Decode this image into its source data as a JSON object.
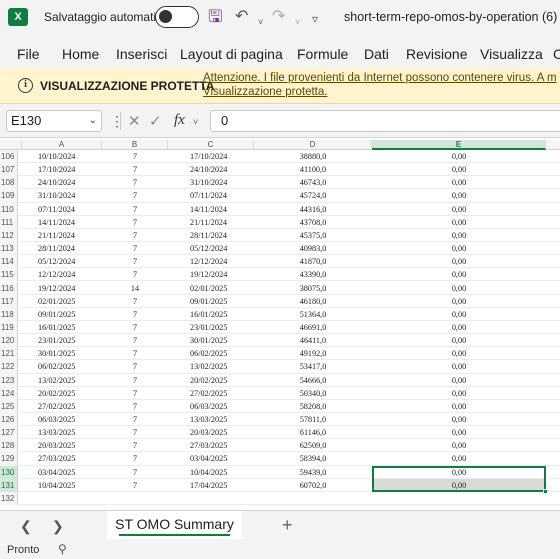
{
  "titlebar": {
    "app_logo": "X",
    "autosave_label": "Salvataggio automatico",
    "autosave_state": "off",
    "save_icon": "save-icon",
    "undo_icon": "undo-icon",
    "redo_icon": "redo-icon",
    "document_title": "short-term-repo-omos-by-operation (6) -"
  },
  "ribbon": {
    "tabs": [
      "File",
      "Home",
      "Inserisci",
      "Layout di pagina",
      "Formule",
      "Dati",
      "Revisione",
      "Visualizza",
      "C"
    ]
  },
  "protected_view": {
    "title": "VISUALIZZAZIONE PROTETTA",
    "message_line1": "Attenzione. I file provenienti da Internet possono contenere virus. A m",
    "message_line2": "Visualizzazione protetta."
  },
  "formula_bar": {
    "name_box": "E130",
    "cancel_icon": "close-icon",
    "confirm_icon": "check-icon",
    "fx_label": "fx",
    "value": "0"
  },
  "grid": {
    "columns": [
      "A",
      "B",
      "C",
      "D",
      "E"
    ],
    "selected_column": "E",
    "selected_cell": "E130",
    "rows": [
      {
        "n": "106",
        "a": "10/10/2024",
        "b": "7",
        "c": "17/10/2024",
        "d": "38880,0",
        "e": "0,00"
      },
      {
        "n": "107",
        "a": "17/10/2024",
        "b": "7",
        "c": "24/10/2024",
        "d": "41100,0",
        "e": "0,00"
      },
      {
        "n": "108",
        "a": "24/10/2024",
        "b": "7",
        "c": "31/10/2024",
        "d": "46743,0",
        "e": "0,00"
      },
      {
        "n": "109",
        "a": "31/10/2024",
        "b": "7",
        "c": "07/11/2024",
        "d": "45724,0",
        "e": "0,00"
      },
      {
        "n": "110",
        "a": "07/11/2024",
        "b": "7",
        "c": "14/11/2024",
        "d": "44316,0",
        "e": "0,00"
      },
      {
        "n": "111",
        "a": "14/11/2024",
        "b": "7",
        "c": "21/11/2024",
        "d": "43708,0",
        "e": "0,00"
      },
      {
        "n": "112",
        "a": "21/11/2024",
        "b": "7",
        "c": "28/11/2024",
        "d": "45375,0",
        "e": "0,00"
      },
      {
        "n": "113",
        "a": "28/11/2024",
        "b": "7",
        "c": "05/12/2024",
        "d": "40983,0",
        "e": "0,00"
      },
      {
        "n": "114",
        "a": "05/12/2024",
        "b": "7",
        "c": "12/12/2024",
        "d": "41870,0",
        "e": "0,00"
      },
      {
        "n": "115",
        "a": "12/12/2024",
        "b": "7",
        "c": "19/12/2024",
        "d": "43390,0",
        "e": "0,00"
      },
      {
        "n": "116",
        "a": "19/12/2024",
        "b": "14",
        "c": "02/01/2025",
        "d": "38075,0",
        "e": "0,00"
      },
      {
        "n": "117",
        "a": "02/01/2025",
        "b": "7",
        "c": "09/01/2025",
        "d": "46180,0",
        "e": "0,00"
      },
      {
        "n": "118",
        "a": "09/01/2025",
        "b": "7",
        "c": "16/01/2025",
        "d": "51364,0",
        "e": "0,00"
      },
      {
        "n": "119",
        "a": "16/01/2025",
        "b": "7",
        "c": "23/01/2025",
        "d": "46691,0",
        "e": "0,00"
      },
      {
        "n": "120",
        "a": "23/01/2025",
        "b": "7",
        "c": "30/01/2025",
        "d": "46411,0",
        "e": "0,00"
      },
      {
        "n": "121",
        "a": "30/01/2025",
        "b": "7",
        "c": "06/02/2025",
        "d": "49192,0",
        "e": "0,00"
      },
      {
        "n": "122",
        "a": "06/02/2025",
        "b": "7",
        "c": "13/02/2025",
        "d": "53417,0",
        "e": "0,00"
      },
      {
        "n": "123",
        "a": "13/02/2025",
        "b": "7",
        "c": "20/02/2025",
        "d": "54666,0",
        "e": "0,00"
      },
      {
        "n": "124",
        "a": "20/02/2025",
        "b": "7",
        "c": "27/02/2025",
        "d": "50340,0",
        "e": "0,00"
      },
      {
        "n": "125",
        "a": "27/02/2025",
        "b": "7",
        "c": "06/03/2025",
        "d": "58208,0",
        "e": "0,00"
      },
      {
        "n": "126",
        "a": "06/03/2025",
        "b": "7",
        "c": "13/03/2025",
        "d": "57811,0",
        "e": "0,00"
      },
      {
        "n": "127",
        "a": "13/03/2025",
        "b": "7",
        "c": "20/03/2025",
        "d": "61146,0",
        "e": "0,00"
      },
      {
        "n": "128",
        "a": "20/03/2025",
        "b": "7",
        "c": "27/03/2025",
        "d": "62509,0",
        "e": "0,00"
      },
      {
        "n": "129",
        "a": "27/03/2025",
        "b": "7",
        "c": "03/04/2025",
        "d": "58394,0",
        "e": "0,00"
      },
      {
        "n": "130",
        "a": "03/04/2025",
        "b": "7",
        "c": "10/04/2025",
        "d": "59439,0",
        "e": "0,00"
      },
      {
        "n": "131",
        "a": "10/04/2025",
        "b": "7",
        "c": "17/04/2025",
        "d": "60702,0",
        "e": "0,00"
      },
      {
        "n": "132",
        "a": "",
        "b": "",
        "c": "",
        "d": "",
        "e": ""
      }
    ]
  },
  "sheets": {
    "active": "ST OMO Summary",
    "prev_icon": "chevron-left-icon",
    "next_icon": "chevron-right-icon",
    "add_icon": "plus-icon"
  },
  "status": {
    "text": "Pronto",
    "icon": "accessibility-icon"
  },
  "colors": {
    "excel_green": "#107c41",
    "protected_bg": "#fff4ce"
  }
}
